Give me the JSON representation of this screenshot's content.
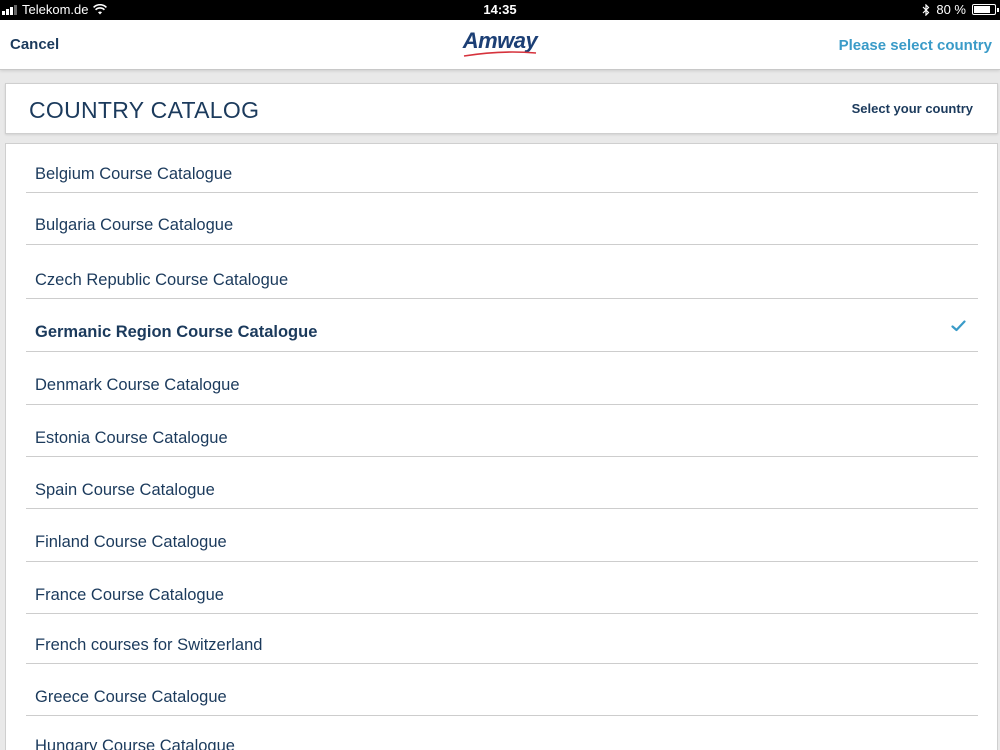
{
  "status_bar": {
    "carrier": "Telekom.de",
    "time": "14:35",
    "battery": "80 %",
    "battery_level": 0.8,
    "icons": [
      "signal-icon",
      "wifi-icon",
      "bluetooth-icon",
      "battery-icon"
    ]
  },
  "nav": {
    "cancel_label": "Cancel",
    "logo_text": "Amway",
    "right_label": "Please select country"
  },
  "header": {
    "title": "COUNTRY CATALOG",
    "hint": "Select your country"
  },
  "list": {
    "items": [
      {
        "label": "Belgium Course Catalogue",
        "selected": false
      },
      {
        "label": "Bulgaria Course Catalogue",
        "selected": false
      },
      {
        "label": "Czech Republic Course Catalogue",
        "selected": false
      },
      {
        "label": "Germanic Region Course Catalogue",
        "selected": true
      },
      {
        "label": "Denmark Course Catalogue",
        "selected": false
      },
      {
        "label": "Estonia Course Catalogue",
        "selected": false
      },
      {
        "label": "Spain Course Catalogue",
        "selected": false
      },
      {
        "label": "Finland Course Catalogue",
        "selected": false
      },
      {
        "label": "France Course Catalogue",
        "selected": false
      },
      {
        "label": "French courses for Switzerland",
        "selected": false
      },
      {
        "label": "Greece Course Catalogue",
        "selected": false
      },
      {
        "label": "Hungary Course Catalogue",
        "selected": false
      }
    ]
  },
  "colors": {
    "brand_navy": "#1b3a5c",
    "accent_blue": "#3a9bc8",
    "logo_red": "#d6323c"
  }
}
